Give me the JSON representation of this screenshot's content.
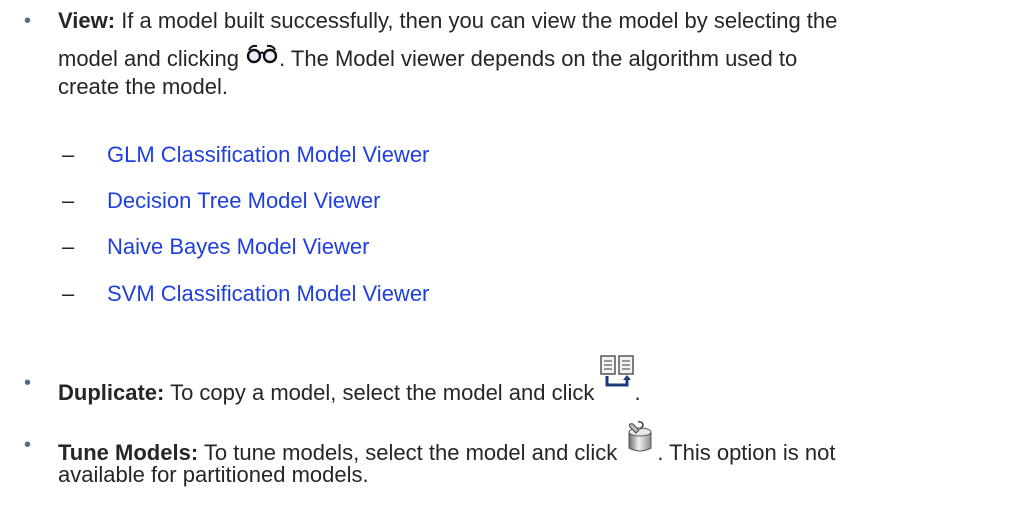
{
  "view": {
    "term": "View:",
    "line1": "If a model built successfully, then you can view the model by selecting the",
    "line2_pre": "model and clicking",
    "line2_post": ". The Model viewer depends on the algorithm used to",
    "line3": "create the model.",
    "icon": "glasses-icon",
    "links": [
      "GLM Classification Model Viewer",
      "Decision Tree Model Viewer",
      "Naive Bayes Model Viewer",
      "SVM Classification Model Viewer"
    ],
    "dash": "–"
  },
  "duplicate": {
    "term": "Duplicate:",
    "text": "To copy a model, select the model and click",
    "post": ".",
    "icon": "duplicate-icon"
  },
  "tune": {
    "term": "Tune Models:",
    "text": "To tune models, select the model and click",
    "post": ". This option is not",
    "line2": "available for partitioned models.",
    "icon": "tune-icon"
  },
  "bullet": "•",
  "colors": {
    "link": "#1f3fe0",
    "bullet": "#4f6b8a",
    "text": "#262626"
  }
}
